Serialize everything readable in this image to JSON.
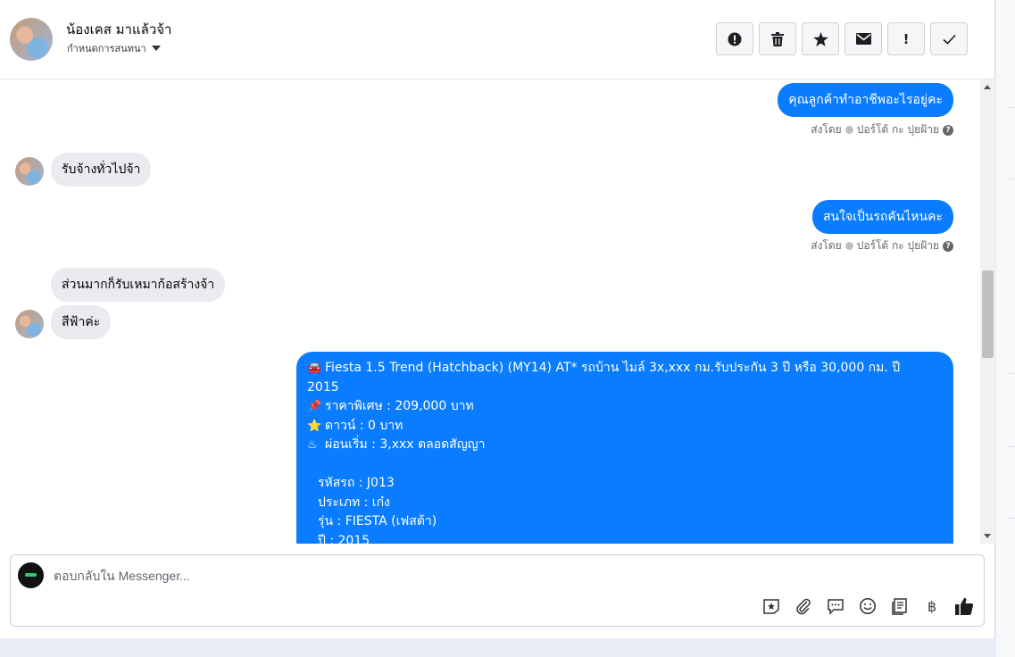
{
  "header": {
    "name": "น้องเคส มาแล้วจ้า",
    "assign_label": "กำหนดการสนทนา",
    "actions": [
      {
        "icon": "alert-circle-icon",
        "glyph": "!"
      },
      {
        "icon": "trash-icon",
        "glyph": "🗑"
      },
      {
        "icon": "star-icon",
        "glyph": "★"
      },
      {
        "icon": "envelope-icon",
        "glyph": "✉"
      },
      {
        "icon": "exclamation-icon",
        "glyph": "!"
      },
      {
        "icon": "check-icon",
        "glyph": "✓"
      }
    ]
  },
  "messages": [
    {
      "dir": "out",
      "text": "คุณลูกค้าทำอาชีพอะไรอยู่คะ",
      "sent_by": "ส่งโดย",
      "sender": "ปอร์โต้ กะ ปุยฝ้าย"
    },
    {
      "dir": "in",
      "text": "รับจ้างทั่วไปจ้า"
    },
    {
      "dir": "out",
      "text": "สนใจเป็นรถคันไหนคะ",
      "sent_by": "ส่งโดย",
      "sender": "ปอร์โต้ กะ ปุยฝ้าย"
    },
    {
      "dir": "in",
      "text": "ส่วนมากก็รับเหมาก้อสร้างจ้า"
    },
    {
      "dir": "in",
      "text": "สีฟ้าค่ะ"
    }
  ],
  "car_message": {
    "line1": "Fiesta 1.5 Trend (Hatchback) (MY14) AT* รถบ้าน ไมล์ 3x,xxx กม.รับประกัน 3 ปี หรือ 30,000 กม. ปี",
    "line2": "2015",
    "price": "ราคาพิเศษ : 209,000 บาท",
    "down": "ดาวน์ : 0 บาท",
    "installment": "ผ่อนเริ่ม : 3,xxx ตลอดสัญญา",
    "code": "รหัสรถ : J013",
    "type": "ประเภท : เก๋ง",
    "model": "รุ่น : FIESTA (เฟสต้า)",
    "year": "ปี : 2015",
    "emoji": {
      "car": "🚘",
      "pin": "📌",
      "star": "⭐",
      "hot": "♨"
    }
  },
  "composer": {
    "placeholder": "ตอบกลับใน Messenger...",
    "tools": [
      "sticker-icon",
      "attachment-icon",
      "saved-reply-icon",
      "emoji-icon",
      "notes-icon",
      "baht-icon",
      "thumbs-up-icon"
    ],
    "baht_glyph": "฿"
  }
}
